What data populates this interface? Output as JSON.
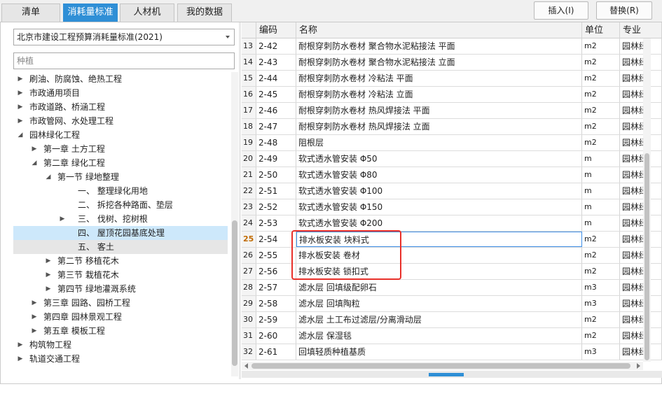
{
  "tabs": [
    {
      "label": "清单",
      "active": false
    },
    {
      "label": "消耗量标准",
      "active": true
    },
    {
      "label": "人材机",
      "active": false
    },
    {
      "label": "我的数据",
      "active": false
    }
  ],
  "toolbar": {
    "insert_label": "插入(I)",
    "replace_label": "替换(R)"
  },
  "left": {
    "standard_select": "北京市建设工程预算消耗量标准(2021)",
    "search_value": "种植",
    "tree": [
      {
        "label": "刷油、防腐蚀、绝热工程",
        "level": 0,
        "toggle": "collapsed"
      },
      {
        "label": "市政通用项目",
        "level": 0,
        "toggle": "collapsed"
      },
      {
        "label": "市政道路、桥涵工程",
        "level": 0,
        "toggle": "collapsed"
      },
      {
        "label": "市政管网、水处理工程",
        "level": 0,
        "toggle": "collapsed"
      },
      {
        "label": "园林绿化工程",
        "level": 0,
        "toggle": "expanded"
      },
      {
        "label": "第一章 土方工程",
        "level": 1,
        "toggle": "collapsed"
      },
      {
        "label": "第二章 绿化工程",
        "level": 1,
        "toggle": "expanded"
      },
      {
        "label": "第一节 绿地整理",
        "level": 2,
        "toggle": "expanded"
      },
      {
        "label": "一、 整理绿化用地",
        "level": 3,
        "toggle": "none"
      },
      {
        "label": "二、 拆挖各种路面、垫层",
        "level": 3,
        "toggle": "none"
      },
      {
        "label": "三、 伐树、挖树根",
        "level": 3,
        "toggle": "collapsed"
      },
      {
        "label": "四、 屋顶花园基底处理",
        "level": 3,
        "toggle": "none",
        "state": "selected"
      },
      {
        "label": "五、 客土",
        "level": 3,
        "toggle": "none",
        "state": "hover"
      },
      {
        "label": "第二节 移植花木",
        "level": 2,
        "toggle": "collapsed"
      },
      {
        "label": "第三节 栽植花木",
        "level": 2,
        "toggle": "collapsed"
      },
      {
        "label": "第四节 绿地灌溉系统",
        "level": 2,
        "toggle": "collapsed"
      },
      {
        "label": "第三章 园路、园桥工程",
        "level": 1,
        "toggle": "collapsed"
      },
      {
        "label": "第四章 园林景观工程",
        "level": 1,
        "toggle": "collapsed"
      },
      {
        "label": "第五章 模板工程",
        "level": 1,
        "toggle": "collapsed"
      },
      {
        "label": "构筑物工程",
        "level": 0,
        "toggle": "collapsed"
      },
      {
        "label": "轨道交通工程",
        "level": 0,
        "toggle": "collapsed"
      }
    ]
  },
  "grid": {
    "columns": [
      "",
      "编码",
      "名称",
      "单位",
      "专业"
    ],
    "rows": [
      {
        "num": "13",
        "code": "2-42",
        "name": "耐根穿刺防水卷材 聚合物水泥粘接法 平面",
        "unit": "m2",
        "major": "园林绿"
      },
      {
        "num": "14",
        "code": "2-43",
        "name": "耐根穿刺防水卷材 聚合物水泥粘接法 立面",
        "unit": "m2",
        "major": "园林绿"
      },
      {
        "num": "15",
        "code": "2-44",
        "name": "耐根穿刺防水卷材 冷粘法 平面",
        "unit": "m2",
        "major": "园林绿"
      },
      {
        "num": "16",
        "code": "2-45",
        "name": "耐根穿刺防水卷材 冷粘法 立面",
        "unit": "m2",
        "major": "园林绿"
      },
      {
        "num": "17",
        "code": "2-46",
        "name": "耐根穿刺防水卷材 热风焊接法 平面",
        "unit": "m2",
        "major": "园林绿"
      },
      {
        "num": "18",
        "code": "2-47",
        "name": "耐根穿刺防水卷材 热风焊接法 立面",
        "unit": "m2",
        "major": "园林绿"
      },
      {
        "num": "19",
        "code": "2-48",
        "name": "阻根层",
        "unit": "m2",
        "major": "园林绿"
      },
      {
        "num": "20",
        "code": "2-49",
        "name": "软式透水管安装 Φ50",
        "unit": "m",
        "major": "园林绿"
      },
      {
        "num": "21",
        "code": "2-50",
        "name": "软式透水管安装 Φ80",
        "unit": "m",
        "major": "园林绿"
      },
      {
        "num": "22",
        "code": "2-51",
        "name": "软式透水管安装 Φ100",
        "unit": "m",
        "major": "园林绿"
      },
      {
        "num": "23",
        "code": "2-52",
        "name": "软式透水管安装 Φ150",
        "unit": "m",
        "major": "园林绿"
      },
      {
        "num": "24",
        "code": "2-53",
        "name": "软式透水管安装 Φ200",
        "unit": "m",
        "major": "园林绿"
      },
      {
        "num": "25",
        "code": "2-54",
        "name": "排水板安装 块料式",
        "unit": "m2",
        "major": "园林绿",
        "active": true
      },
      {
        "num": "26",
        "code": "2-55",
        "name": "排水板安装 卷材",
        "unit": "m2",
        "major": "园林绿"
      },
      {
        "num": "27",
        "code": "2-56",
        "name": "排水板安装 锁扣式",
        "unit": "m2",
        "major": "园林绿"
      },
      {
        "num": "28",
        "code": "2-57",
        "name": "滤水层 回填级配卵石",
        "unit": "m3",
        "major": "园林绿"
      },
      {
        "num": "29",
        "code": "2-58",
        "name": "滤水层 回填陶粒",
        "unit": "m3",
        "major": "园林绿"
      },
      {
        "num": "30",
        "code": "2-59",
        "name": "滤水层 土工布过滤层/分离滑动层",
        "unit": "m2",
        "major": "园林绿"
      },
      {
        "num": "31",
        "code": "2-60",
        "name": "滤水层 保湿毯",
        "unit": "m2",
        "major": "园林绿"
      },
      {
        "num": "32",
        "code": "2-61",
        "name": "回填轻质种植基质",
        "unit": "m3",
        "major": "园林绿"
      }
    ]
  },
  "colors": {
    "accent": "#2f8fd6",
    "selected_tree": "#cde8fb",
    "annotation": "#e8302a",
    "focus_border": "#3e8ee6"
  }
}
